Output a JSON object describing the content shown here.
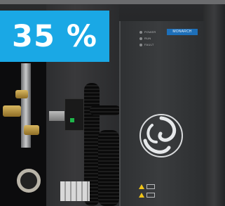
{
  "badge": {
    "percent": "35 %",
    "color": "#1aa8e5"
  },
  "inverter": {
    "brand": "MONARCH",
    "indicators": [
      {
        "label": "POWER"
      },
      {
        "label": "RUN"
      },
      {
        "label": "FAULT"
      }
    ],
    "logo_icon": "swirl-logo-icon",
    "warning_icons": [
      "warning-triangle-icon",
      "warning-triangle-icon"
    ]
  }
}
